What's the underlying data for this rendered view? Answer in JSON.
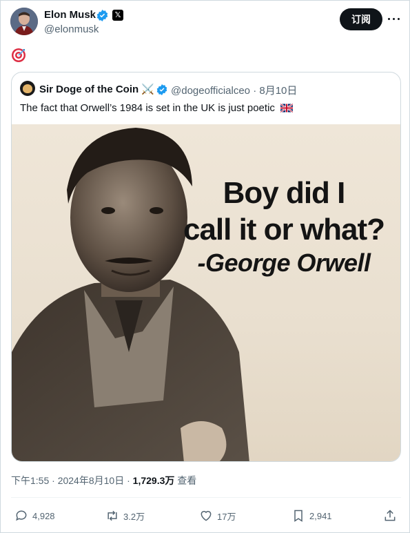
{
  "author": {
    "name": "Elon Musk",
    "handle": "@elonmusk",
    "verified_color": "#1d9bf0",
    "badge": "𝕏"
  },
  "header": {
    "subscribe_label": "订阅",
    "more_icon": "ellipsis-icon"
  },
  "tweet": {
    "emoji_icon": "target-emoji"
  },
  "quote": {
    "name": "Sir Doge of the Coin",
    "name_emoji": "⚔️",
    "handle": "@dogeofficialceo",
    "separator": "·",
    "date": "8月10日",
    "text": "The fact that Orwell’s 1984 is set in the UK is just poetic",
    "flag_icon": "uk-flag-emoji",
    "image": {
      "caption_line1": "Boy did I",
      "caption_line2": "call it or what?",
      "caption_line3": "-George Orwell"
    }
  },
  "footer": {
    "time": "下午1:55",
    "dot": "·",
    "date": "2024年8月10日",
    "dot2": "·",
    "views": "1,729.3万",
    "views_label": "查看"
  },
  "actions": {
    "reply": "4,928",
    "retweet": "3.2万",
    "like": "17万",
    "bookmark": "2,941"
  },
  "colors": {
    "accent": "#1d9bf0",
    "text": "#0f1419",
    "secondary": "#536471",
    "border": "#cfd9de"
  }
}
